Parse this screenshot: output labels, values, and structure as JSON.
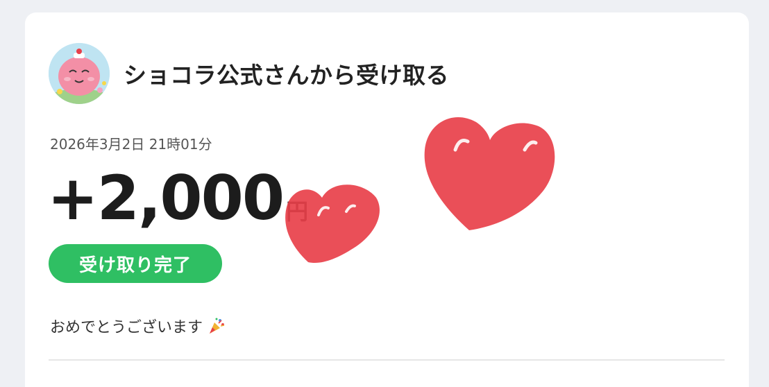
{
  "receipt": {
    "title": "ショコラ公式さんから受け取る",
    "timestamp": "2026年3月2日 21時01分",
    "amount": "+2,000",
    "currency": "円",
    "status": "受け取り完了",
    "message": "おめでとうございます",
    "message_icon": "party-popper-icon"
  },
  "colors": {
    "status_green": "#2fbf63",
    "heart_red": "#e8404a",
    "avatar_pink": "#f38fa6"
  }
}
